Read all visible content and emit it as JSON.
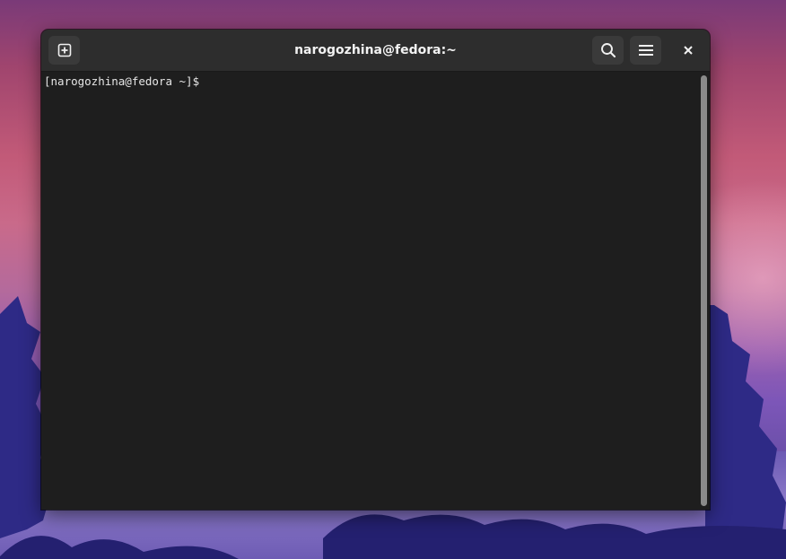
{
  "window": {
    "title": "narogozhina@fedora:~"
  },
  "headerbar": {
    "new_tab_icon": "new-tab-icon",
    "search_icon": "search-icon",
    "menu_icon": "hamburger-menu-icon",
    "close_icon": "close-icon"
  },
  "terminal": {
    "prompt": "[narogozhina@fedora ~]$ "
  },
  "colors": {
    "terminal_background": "#1e1e1e",
    "headerbar_background": "#2d2d2d",
    "terminal_foreground": "#e6e6e6"
  }
}
